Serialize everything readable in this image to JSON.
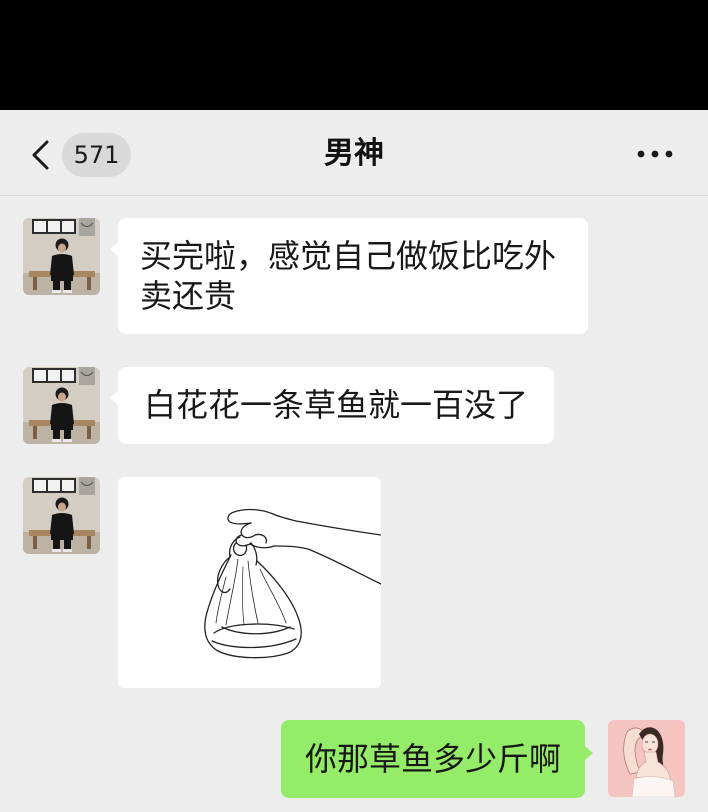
{
  "header": {
    "unread_count": "571",
    "title": "男神"
  },
  "icons": {
    "back": "back-chevron-icon",
    "more": "more-dots-icon"
  },
  "messages": [
    {
      "outgoing": false,
      "text": "买完啦，感觉自己做饭比吃外卖还贵"
    },
    {
      "outgoing": false,
      "text": "白花花一条草鱼就一百没了"
    },
    {
      "outgoing": false,
      "image": true
    },
    {
      "outgoing": true,
      "text": "你那草鱼多少斤啊"
    }
  ],
  "colors": {
    "top_bar": "#000000",
    "background": "#ededed",
    "incoming_bubble": "#ffffff",
    "outgoing_bubble": "#95ec69",
    "badge": "#d9d9d9"
  }
}
